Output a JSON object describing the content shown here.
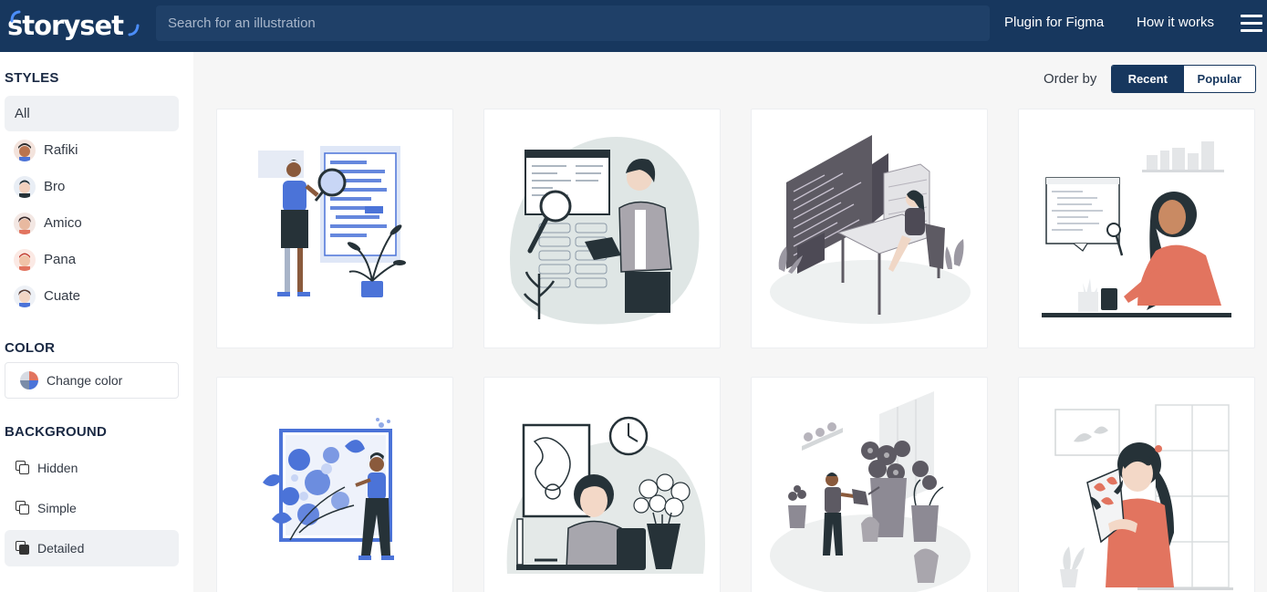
{
  "header": {
    "logo_text": "storyset",
    "search_placeholder": "Search for an illustration",
    "nav": {
      "plugin": "Plugin for Figma",
      "how": "How it works"
    }
  },
  "sidebar": {
    "styles_title": "STYLES",
    "styles": [
      {
        "label": "All",
        "active": true
      },
      {
        "label": "Rafiki",
        "icon": "rafiki-avatar-icon"
      },
      {
        "label": "Bro",
        "icon": "bro-avatar-icon"
      },
      {
        "label": "Amico",
        "icon": "amico-avatar-icon"
      },
      {
        "label": "Pana",
        "icon": "pana-avatar-icon"
      },
      {
        "label": "Cuate",
        "icon": "cuate-avatar-icon"
      }
    ],
    "color_title": "COLOR",
    "change_color_label": "Change color",
    "background_title": "BACKGROUND",
    "backgrounds": [
      {
        "label": "Hidden"
      },
      {
        "label": "Simple"
      },
      {
        "label": "Detailed",
        "active": true
      }
    ]
  },
  "main": {
    "order_label": "Order by",
    "order_options": [
      {
        "label": "Recent",
        "active": true
      },
      {
        "label": "Popular"
      }
    ]
  },
  "colors": {
    "header_bg": "#17375e",
    "accent_blue": "#4b73d8",
    "accent_coral": "#e2745f",
    "dark_slate": "#4d4a55"
  }
}
